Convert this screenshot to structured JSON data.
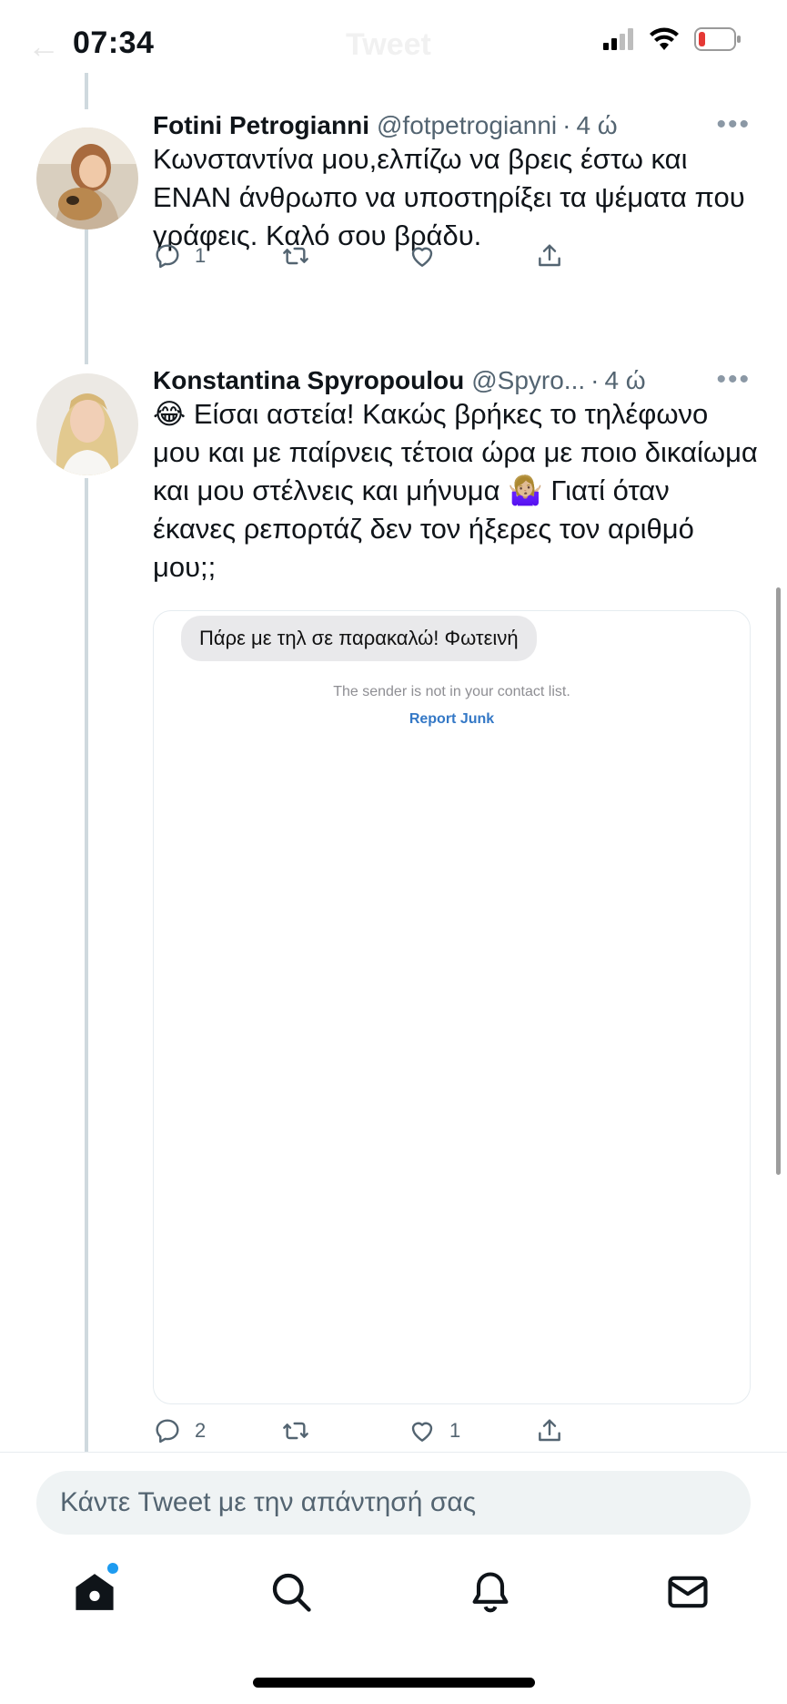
{
  "status_bar": {
    "time": "07:34",
    "faded_title": "Tweet"
  },
  "tweets": [
    {
      "name": "Fotini Petrogianni",
      "handle": "@fotpetrogianni",
      "time": "4 ώ",
      "text": "Κωνσταντίνα μου,ελπίζω να βρεις έστω και ΕΝΑΝ άνθρωπο να υποστηρίξει τα ψέματα που γράφεις. Καλό σου βράδυ.",
      "reply_count": "1",
      "retweet_count": "",
      "like_count": ""
    },
    {
      "name": "Konstantina Spyropoulou",
      "handle": "@Spyro...",
      "time": "4 ώ",
      "text": "😂 Είσαι αστεία! Κακώς βρήκες το τηλέφωνο μου και με παίρνεις τέτοια ώρα με ποιο δικαίωμα και μου στέλνεις και μήνυμα 🤷🏼‍♀️ Γιατί όταν έκανες ρεπορτάζ δεν τον ήξερες τον αριθμό μου;;",
      "reply_count": "2",
      "retweet_count": "",
      "like_count": "1",
      "media": {
        "message_bubble": "Πάρε με τηλ σε παρακαλώ! Φωτεινή",
        "sender_note": "The sender is not in your contact list.",
        "report_link": "Report Junk"
      }
    }
  ],
  "compose": {
    "placeholder": "Κάντε Tweet με την απάντησή σας"
  },
  "tabs": [
    "home-icon",
    "search-icon",
    "notifications-icon",
    "messages-icon"
  ],
  "colors": {
    "accent": "#1d9bf0",
    "secondary_text": "#536471",
    "thread_line": "#cfd9de",
    "compose_bg": "#eff3f4"
  }
}
